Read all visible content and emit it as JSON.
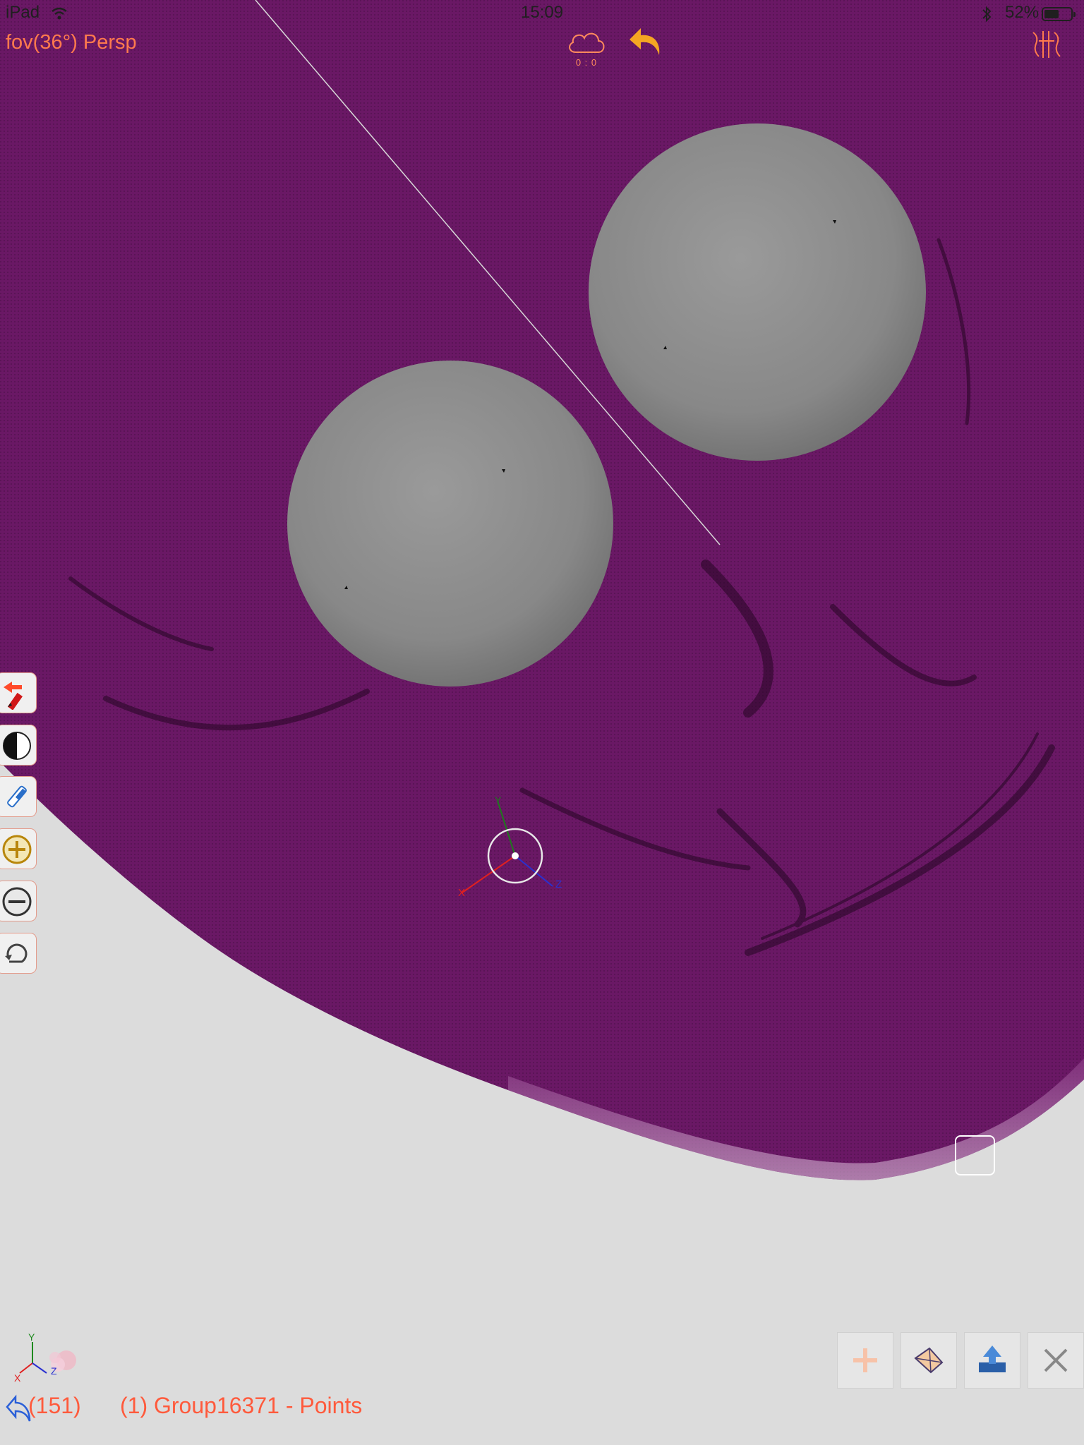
{
  "status_bar": {
    "device": "iPad",
    "time": "15:09",
    "battery": "52%"
  },
  "view": {
    "label": "fov(36°) Persp"
  },
  "cloud": {
    "counter": "0 : 0"
  },
  "gizmo": {
    "x_label": "X",
    "y_label": "Y",
    "z_label": "Z"
  },
  "axes_logo": {
    "x_label": "X",
    "y_label": "Y",
    "z_label": "Z"
  },
  "footer": {
    "count": "(151)",
    "selection": "(1) Group16371 - Points"
  },
  "icons": {
    "top": [
      "cloud-icon",
      "undo-icon",
      "menu-icon"
    ],
    "side": [
      "edit-mode-icon",
      "shading-icon",
      "eraser-icon",
      "zoom-in-icon",
      "zoom-out-icon",
      "rotate-icon"
    ],
    "bottom": [
      "add-icon",
      "mesh-icon",
      "export-icon",
      "close-icon"
    ]
  },
  "colors": {
    "mesh": "#6a1865",
    "sphere": "#8c8c8c",
    "background": "#dcdcdc",
    "accent": "#ff7a4d",
    "undo": "#f5a623"
  }
}
